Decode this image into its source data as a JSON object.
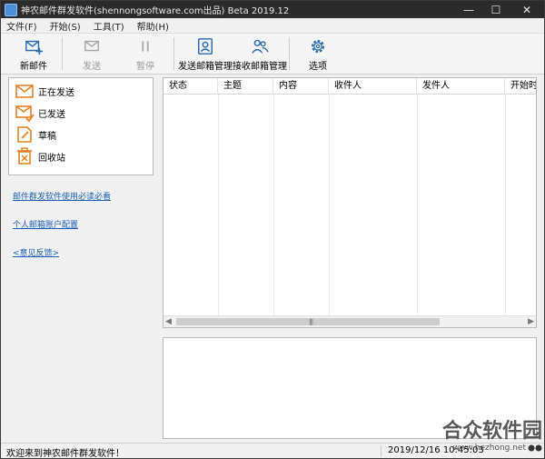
{
  "window": {
    "title": "神农邮件群发软件(shennongsoftware.com出品) Beta 2019.12",
    "controls": {
      "minimize": "—",
      "maximize": "☐",
      "close": "✕"
    }
  },
  "menu": [
    "文件(F)",
    "开始(S)",
    "工具(T)",
    "帮助(H)"
  ],
  "toolbar": {
    "new_mail": "新邮件",
    "send": "发送",
    "pause": "暂停",
    "send_mailbox_mgmt": "发送邮箱管理",
    "receive_mailbox_mgmt": "接收邮箱管理",
    "options": "选项",
    "accent": "#2a6ab0",
    "disabled_color": "#a8a8a8"
  },
  "folders": [
    {
      "label": "正在发送",
      "icon": "envelope-open-icon"
    },
    {
      "label": "已发送",
      "icon": "envelope-check-icon"
    },
    {
      "label": "草稿",
      "icon": "draft-pencil-icon"
    },
    {
      "label": "回收站",
      "icon": "trash-icon"
    }
  ],
  "folder_icon_color": "#e8801e",
  "links": {
    "usage_guide": "邮件群发软件使用必读必看",
    "account_config": "个人邮箱账户配置",
    "feedback": "<意见反馈>"
  },
  "table": {
    "columns": [
      "状态",
      "主题",
      "内容",
      "收件人",
      "发件人",
      "开始时间"
    ],
    "rows": [],
    "scroll_grip": "|||"
  },
  "status": {
    "message": "欢迎来到神农邮件群发软件！",
    "datetime": "2019/12/16 10:45:03"
  },
  "watermark": {
    "text": "合众软件园",
    "url": "www.hezhong.net"
  }
}
